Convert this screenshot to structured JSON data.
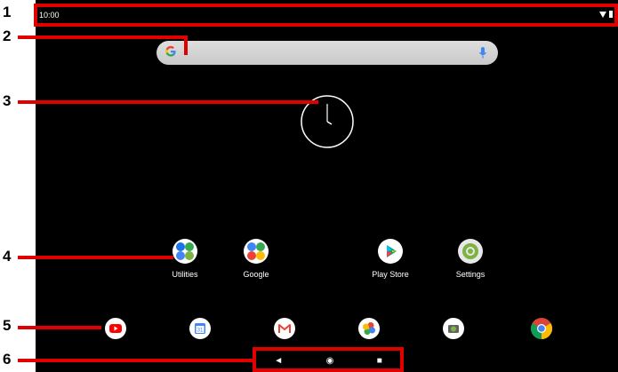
{
  "status_bar": {
    "time": "10:00"
  },
  "search": {
    "logo_letter": "G"
  },
  "home_apps": [
    {
      "label": "Utilities"
    },
    {
      "label": "Google"
    },
    {
      "label": "Play Store"
    },
    {
      "label": "Settings"
    }
  ],
  "dock_apps": [
    "youtube-icon",
    "calendar-icon",
    "gmail-icon",
    "photos-icon",
    "camera-icon",
    "chrome-icon"
  ],
  "calendar_day": "31",
  "nav": {
    "back": "◄",
    "home": "◉",
    "recents": "■"
  },
  "callouts": [
    "1",
    "2",
    "3",
    "4",
    "5",
    "6"
  ],
  "colors": {
    "annotation": "#e00000",
    "screen": "#000000"
  }
}
